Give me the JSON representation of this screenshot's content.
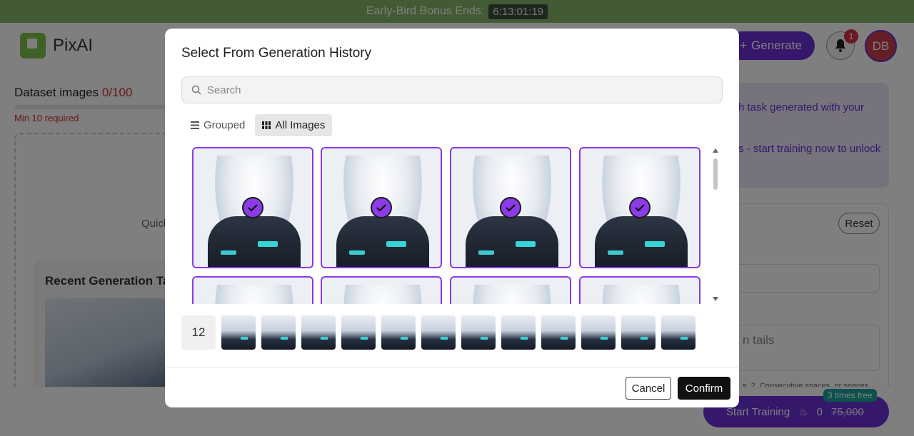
{
  "banner": {
    "label": "Early-Bird Bonus Ends:",
    "timer": "6:13:01:19"
  },
  "header": {
    "brand": "PixAI",
    "generate_label": "Generate",
    "notification_count": "1",
    "avatar_initials": "DB"
  },
  "background": {
    "dataset_label": "Dataset images",
    "dataset_count": "0/100",
    "min_required": "Min 10 required",
    "quick_text": "Quick",
    "recent_title": "Recent Generation Ta",
    "info_line1": "h task generated with your",
    "info_line2": "s - start training now to unlock",
    "reset_label": "Reset",
    "field_placeholder": "n tails",
    "hint_text": "s, 2. Consecutive spaces, or spaces",
    "start_label": "Start Training",
    "credits": "0",
    "original_price": "75,000",
    "free_badge": "3 times free"
  },
  "modal": {
    "title": "Select From Generation History",
    "search": {
      "placeholder": "Search",
      "value": ""
    },
    "tabs": [
      {
        "label": "Grouped",
        "icon": "list-icon",
        "active": false
      },
      {
        "label": "All Images",
        "icon": "grid-icon",
        "active": true
      }
    ],
    "selected_count": "12",
    "cancel_label": "Cancel",
    "confirm_label": "Confirm"
  },
  "colors": {
    "accent": "#6a2fd6",
    "selection_border": "#8c3be8",
    "banner_bg": "#87b66b",
    "danger": "#d12c2c",
    "confirm_bg": "#111111"
  }
}
